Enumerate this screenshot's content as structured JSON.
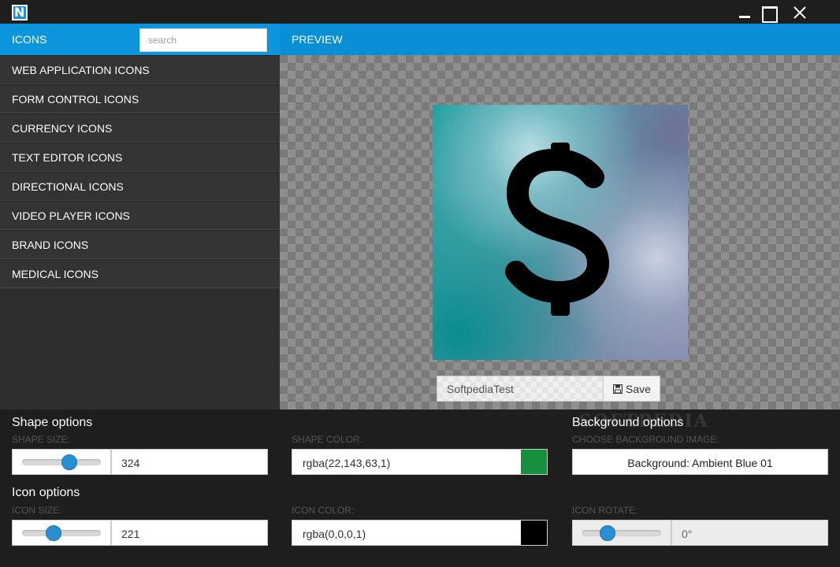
{
  "titlebar": {
    "logo_letter": "N",
    "icons": [
      "app-logo",
      "minimize-icon",
      "maximize-icon",
      "close-icon"
    ]
  },
  "sidebar": {
    "header": "ICONS",
    "search_placeholder": "search",
    "items": [
      {
        "label": "WEB APPLICATION ICONS"
      },
      {
        "label": "FORM CONTROL ICONS"
      },
      {
        "label": "CURRENCY ICONS"
      },
      {
        "label": "TEXT EDITOR ICONS"
      },
      {
        "label": "DIRECTIONAL ICONS"
      },
      {
        "label": "VIDEO PLAYER ICONS"
      },
      {
        "label": "BRAND ICONS"
      },
      {
        "label": "MEDICAL ICONS"
      }
    ]
  },
  "preview": {
    "header": "PREVIEW",
    "icon_glyph": "dollar-icon",
    "filename_value": "SoftpediaTest",
    "save_label": "Save"
  },
  "shape_options": {
    "title": "Shape options",
    "size_label": "SHAPE SIZE:",
    "size_value": "324",
    "size_slider_fraction": 0.6,
    "color_label": "SHAPE COLOR:",
    "color_value": "rgba(22,143,63,1)",
    "color_swatch": "#168f3f"
  },
  "background_options": {
    "title": "Background options",
    "image_label": "CHOOSE BACKGROUND IMAGE:",
    "image_button": "Background: Ambient Blue 01",
    "watermark": "SOFTPEDIA"
  },
  "icon_options": {
    "title": "Icon options",
    "size_label": "ICON SIZE:",
    "size_value": "221",
    "size_slider_fraction": 0.4,
    "color_label": "ICON COLOR:",
    "color_value": "rgba(0,0,0,1)",
    "color_swatch": "#000000",
    "rotate_label": "ICON ROTATE:",
    "rotate_value": "0°",
    "rotate_slider_fraction": 0.32
  },
  "colors": {
    "accent": "#0a8fd5",
    "sidebar_bg": "#333333",
    "panel_bg": "#1e1e1e"
  }
}
